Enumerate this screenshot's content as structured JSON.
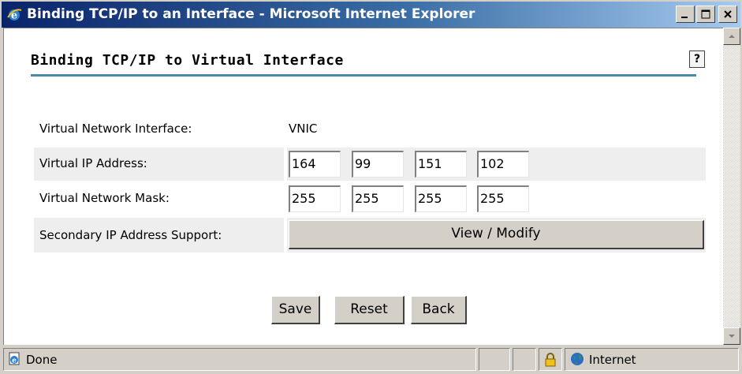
{
  "window": {
    "title": "Binding TCP/IP to an Interface - Microsoft Internet Explorer"
  },
  "page": {
    "title": "Binding TCP/IP to Virtual Interface",
    "help_glyph": "?"
  },
  "form": {
    "interface": {
      "label": "Virtual Network Interface:",
      "value": "VNIC"
    },
    "ip": {
      "label": "Virtual IP Address:",
      "octets": [
        "164",
        "99",
        "151",
        "102"
      ]
    },
    "mask": {
      "label": "Virtual Network Mask:",
      "octets": [
        "255",
        "255",
        "255",
        "255"
      ]
    },
    "secondary": {
      "label": "Secondary IP Address Support:",
      "button": "View / Modify"
    }
  },
  "buttons": {
    "save": "Save",
    "reset": "Reset",
    "back": "Back"
  },
  "status": {
    "text": "Done",
    "zone": "Internet"
  },
  "colors": {
    "title_rule": "#4a8aa8",
    "titlebar_start": "#0a246a",
    "titlebar_end": "#a6caf0"
  }
}
